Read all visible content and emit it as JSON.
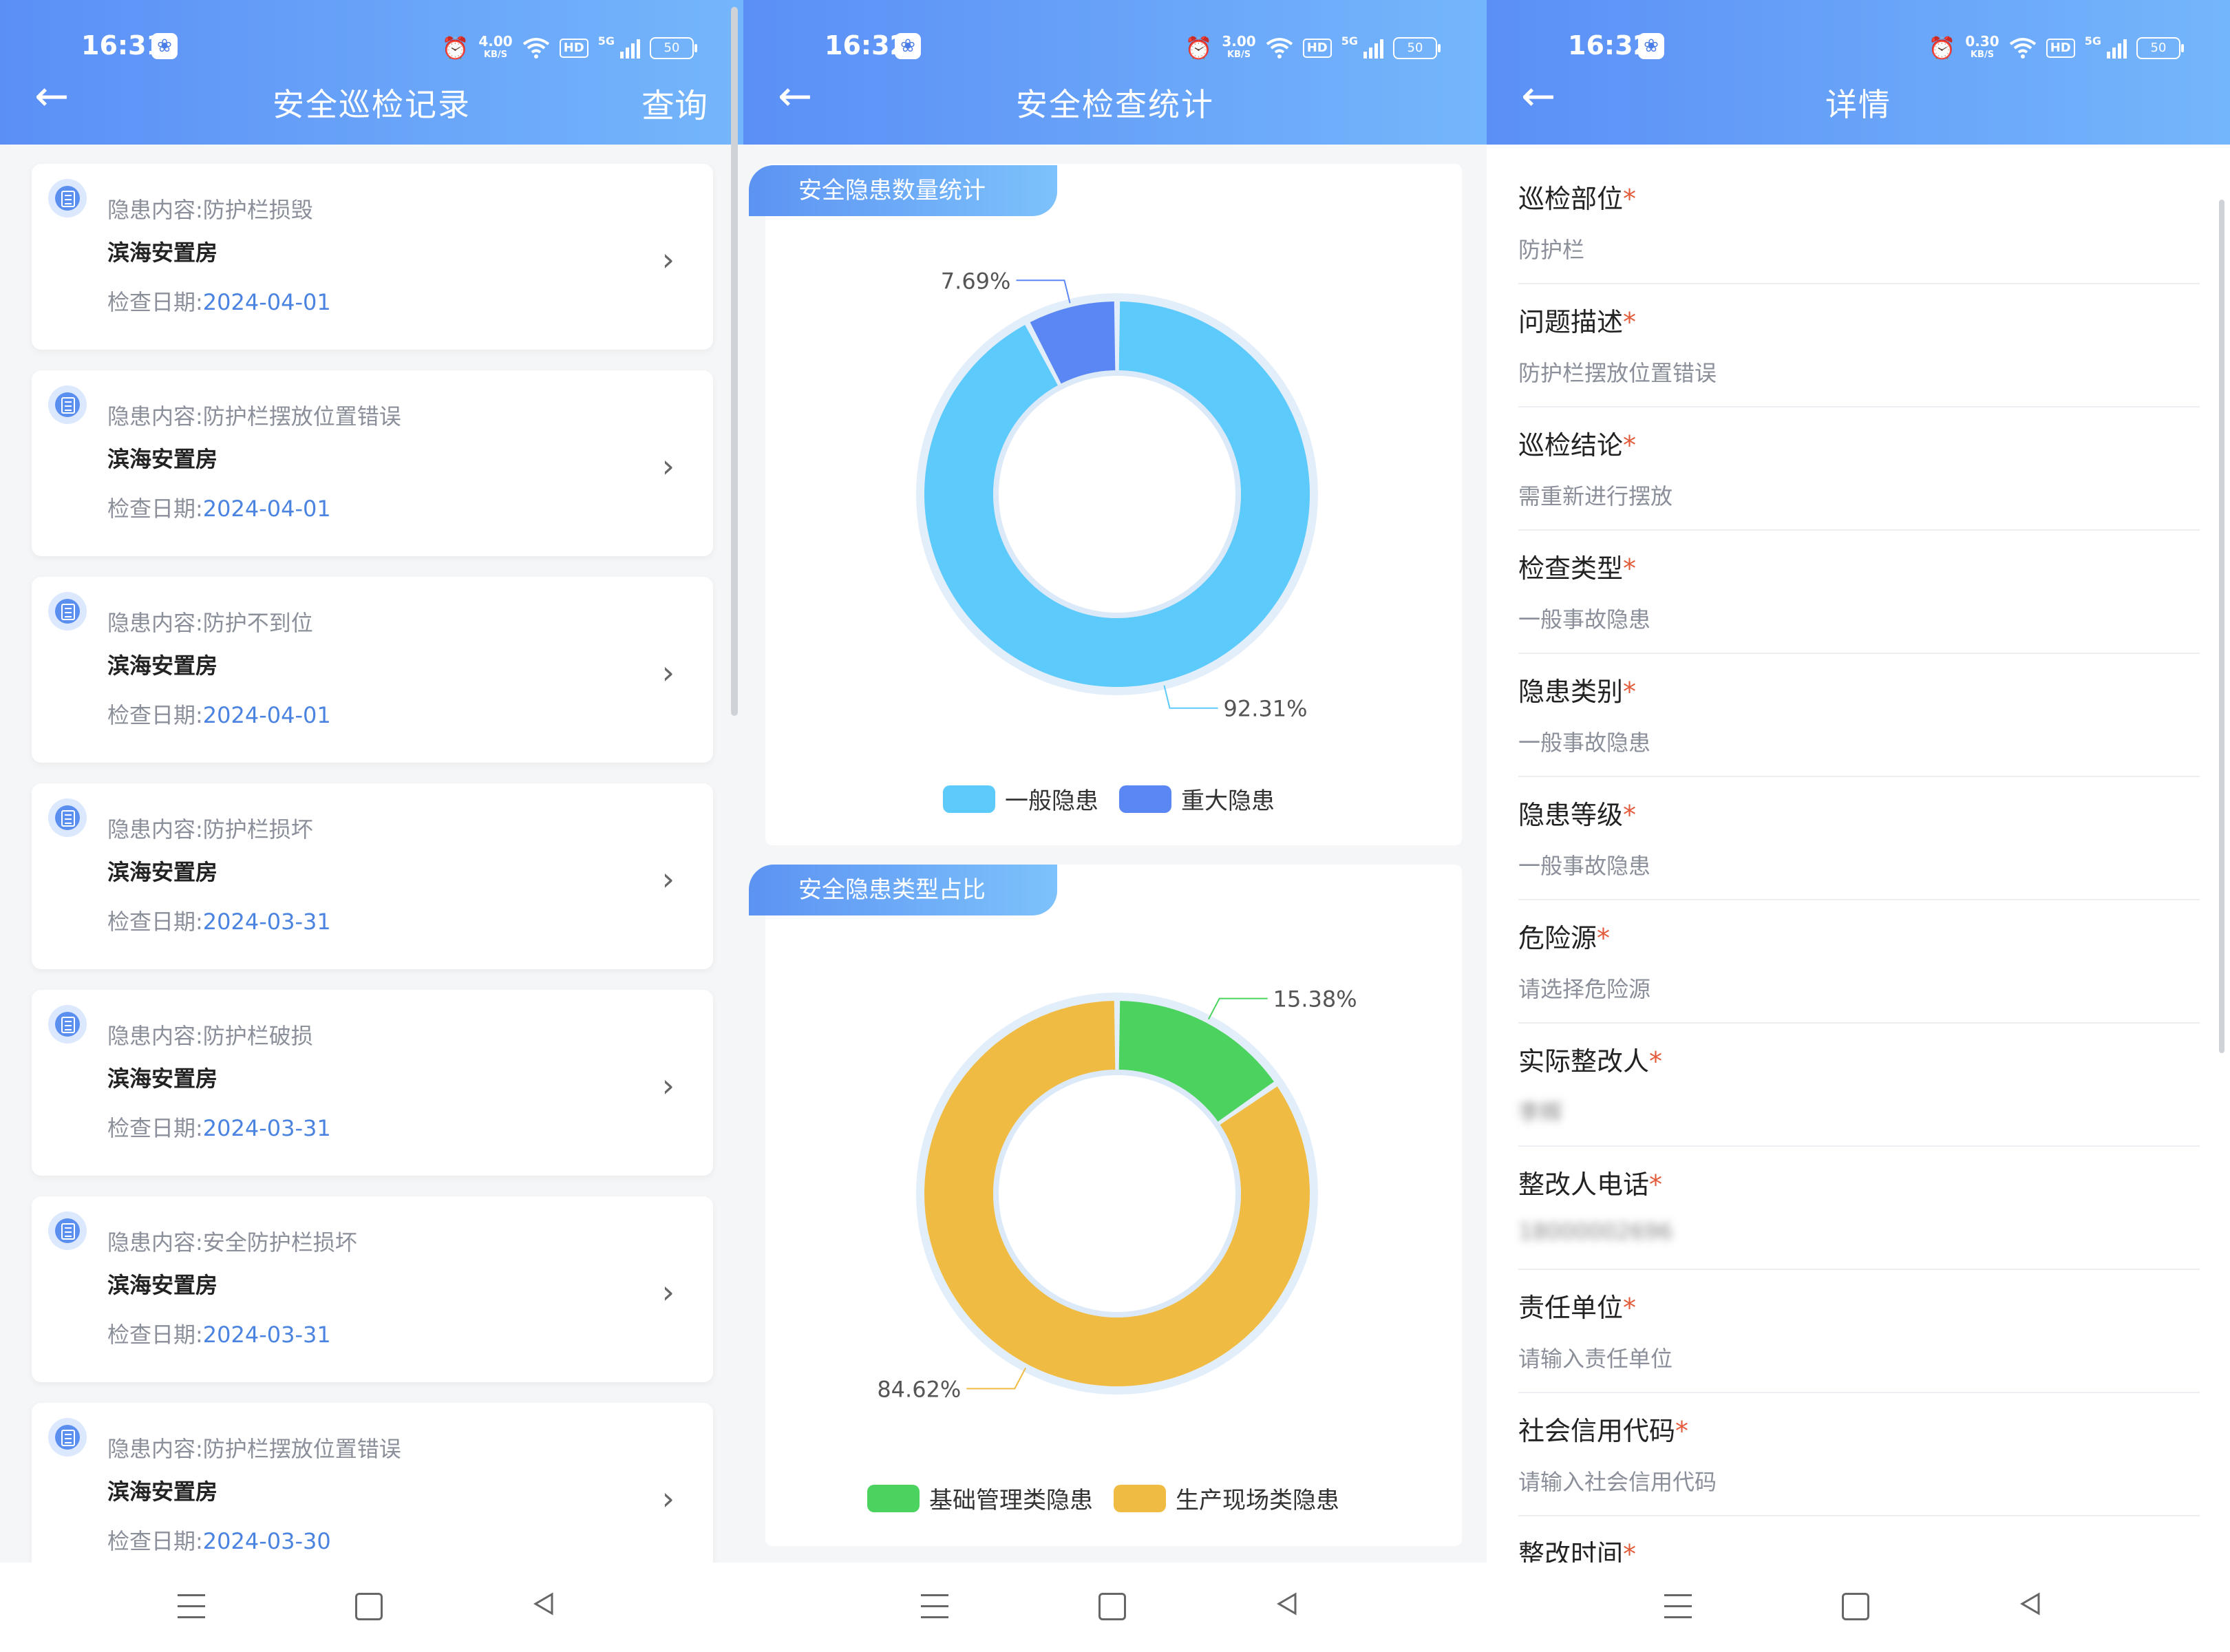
{
  "status": [
    {
      "time": "16:31",
      "speed_value": "4.00",
      "speed_unit": "KB/S",
      "battery": "50"
    },
    {
      "time": "16:32",
      "speed_value": "3.00",
      "speed_unit": "KB/S",
      "battery": "50"
    },
    {
      "time": "16:32",
      "speed_value": "0.30",
      "speed_unit": "KB/S",
      "battery": "50"
    }
  ],
  "status_hd": "HD",
  "status_5g": "5G",
  "list_screen": {
    "title": "安全巡检记录",
    "query_label": "查询",
    "date_prefix": "检查日期:",
    "records": [
      {
        "content": "隐患内容:防护栏损毁",
        "place": "滨海安置房",
        "date": "2024-04-01"
      },
      {
        "content": "隐患内容:防护栏摆放位置错误",
        "place": "滨海安置房",
        "date": "2024-04-01"
      },
      {
        "content": "隐患内容:防护不到位",
        "place": "滨海安置房",
        "date": "2024-04-01"
      },
      {
        "content": "隐患内容:防护栏损坏",
        "place": "滨海安置房",
        "date": "2024-03-31"
      },
      {
        "content": "隐患内容:防护栏破损",
        "place": "滨海安置房",
        "date": "2024-03-31"
      },
      {
        "content": "隐患内容:安全防护栏损坏",
        "place": "滨海安置房",
        "date": "2024-03-31"
      },
      {
        "content": "隐患内容:防护栏摆放位置错误",
        "place": "滨海安置房",
        "date": "2024-03-30"
      }
    ]
  },
  "stats_screen": {
    "title": "安全检查统计",
    "section1_title": "安全隐患数量统计",
    "section2_title": "安全隐患类型占比"
  },
  "chart_data": [
    {
      "type": "pie",
      "title": "安全隐患数量统计",
      "categories": [
        "一般隐患",
        "重大隐患"
      ],
      "values": [
        92.31,
        7.69
      ],
      "labels": [
        "92.31%",
        "7.69%"
      ],
      "colors": [
        "#5ccafa",
        "#5b87f5"
      ],
      "donut": true,
      "legend": "bottom"
    },
    {
      "type": "pie",
      "title": "安全隐患类型占比",
      "categories": [
        "基础管理类隐患",
        "生产现场类隐患"
      ],
      "values": [
        15.38,
        84.62
      ],
      "labels": [
        "15.38%",
        "84.62%"
      ],
      "colors": [
        "#4cd35f",
        "#f0bb42"
      ],
      "donut": true,
      "legend": "bottom"
    }
  ],
  "detail_screen": {
    "title": "详情",
    "required_mark": "*",
    "fields": [
      {
        "label": "巡检部位",
        "value": "防护栏"
      },
      {
        "label": "问题描述",
        "value": "防护栏摆放位置错误"
      },
      {
        "label": "巡检结论",
        "value": "需重新进行摆放"
      },
      {
        "label": "检查类型",
        "value": "一般事故隐患"
      },
      {
        "label": "隐患类别",
        "value": "一般事故隐患"
      },
      {
        "label": "隐患等级",
        "value": "一般事故隐患"
      },
      {
        "label": "危险源",
        "value": "请选择危险源"
      },
      {
        "label": "实际整改人",
        "value": "李辉"
      },
      {
        "label": "整改人电话",
        "value": "18000002696"
      },
      {
        "label": "责任单位",
        "value": "请输入责任单位"
      },
      {
        "label": "社会信用代码",
        "value": "请输入社会信用代码"
      },
      {
        "label": "整改时间",
        "value": ""
      }
    ]
  }
}
